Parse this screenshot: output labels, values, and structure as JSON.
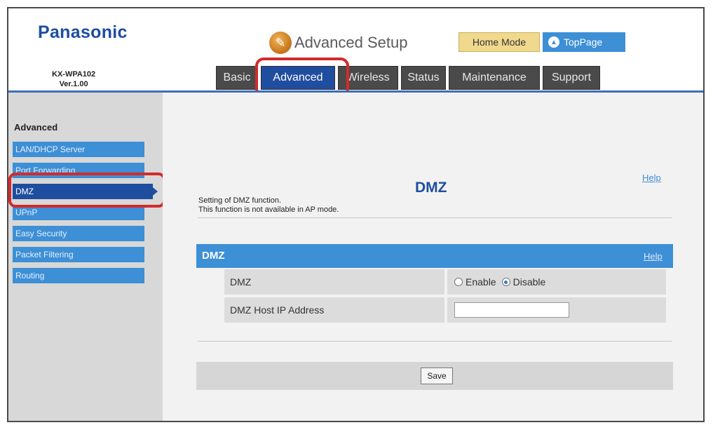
{
  "brand": "Panasonic",
  "model": {
    "name": "KX-WPA102",
    "version": "Ver.1.00"
  },
  "header": {
    "title": "Advanced Setup",
    "home_mode": "Home Mode",
    "top_page": "TopPage"
  },
  "tabs": [
    {
      "label": "Basic",
      "active": false
    },
    {
      "label": "Advanced",
      "active": true
    },
    {
      "label": "Wireless",
      "active": false
    },
    {
      "label": "Status",
      "active": false
    },
    {
      "label": "Maintenance",
      "active": false
    },
    {
      "label": "Support",
      "active": false
    }
  ],
  "sidebar": {
    "heading": "Advanced",
    "items": [
      {
        "label": "LAN/DHCP Server",
        "active": false
      },
      {
        "label": "Port Forwarding",
        "active": false
      },
      {
        "label": "DMZ",
        "active": true
      },
      {
        "label": "UPnP",
        "active": false
      },
      {
        "label": "Easy Security",
        "active": false
      },
      {
        "label": "Packet Filtering",
        "active": false
      },
      {
        "label": "Routing",
        "active": false
      }
    ]
  },
  "page": {
    "title": "DMZ",
    "help": "Help",
    "description_line1": "Setting of DMZ function.",
    "description_line2": "This function is not available in AP mode."
  },
  "section": {
    "title": "DMZ",
    "help": "Help",
    "dmz_label": "DMZ",
    "enable_label": "Enable",
    "disable_label": "Disable",
    "selected": "Disable",
    "host_ip_label": "DMZ Host IP Address",
    "host_ip_value": ""
  },
  "save_label": "Save",
  "colors": {
    "brand": "#1b4ea3",
    "tab_active": "#1f4ea0",
    "sidebar_item": "#3d8fd6",
    "highlight": "#d32a2a"
  }
}
